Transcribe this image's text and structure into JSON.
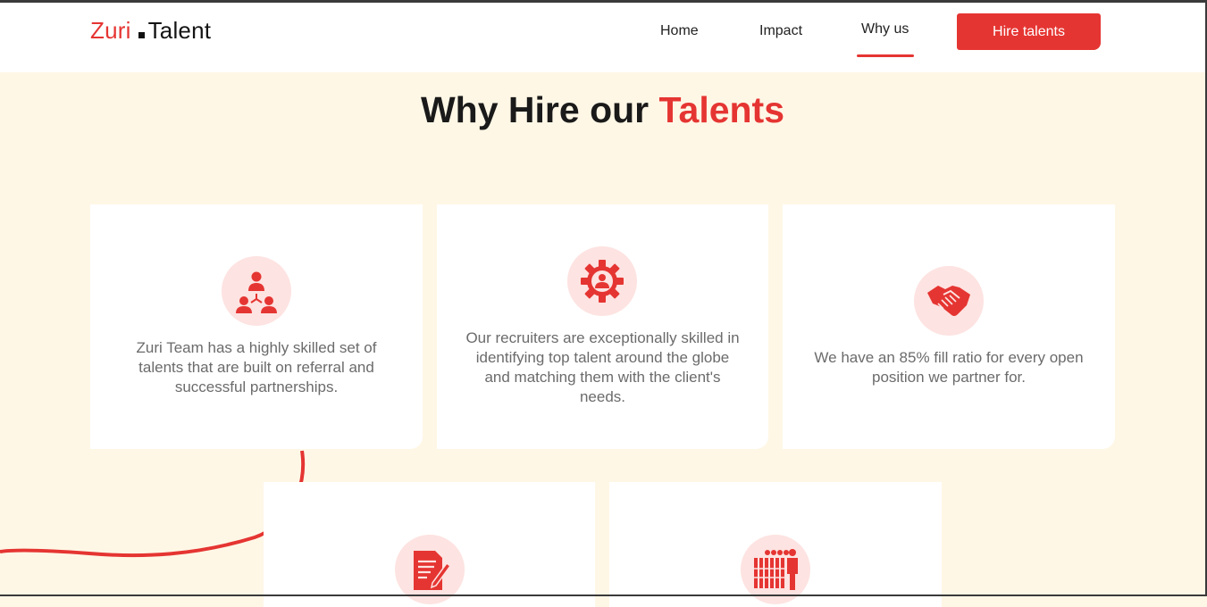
{
  "brand": {
    "part1": "Zuri",
    "part2": "Talent"
  },
  "nav": {
    "home": "Home",
    "impact": "Impact",
    "why_us": "Why us",
    "hire_button": "Hire talents"
  },
  "hero": {
    "title_main": "Why Hire our ",
    "title_accent": "Talents"
  },
  "cards": [
    {
      "icon": "team-network-icon",
      "text": "Zuri Team has a highly skilled set of talents that are built on referral and successful partnerships."
    },
    {
      "icon": "gear-person-icon",
      "text": "Our recruiters are exceptionally skilled in identifying top talent around the globe and matching them with the client's needs."
    },
    {
      "icon": "handshake-icon",
      "text": "We have an 85% fill ratio for every open position we partner for."
    },
    {
      "icon": "document-edit-icon",
      "text": ""
    },
    {
      "icon": "crowd-icon",
      "text": ""
    }
  ],
  "colors": {
    "accent": "#e53532",
    "background": "#fff7e6",
    "icon_bg": "#fde3e1",
    "text": "#6b6b6b"
  }
}
